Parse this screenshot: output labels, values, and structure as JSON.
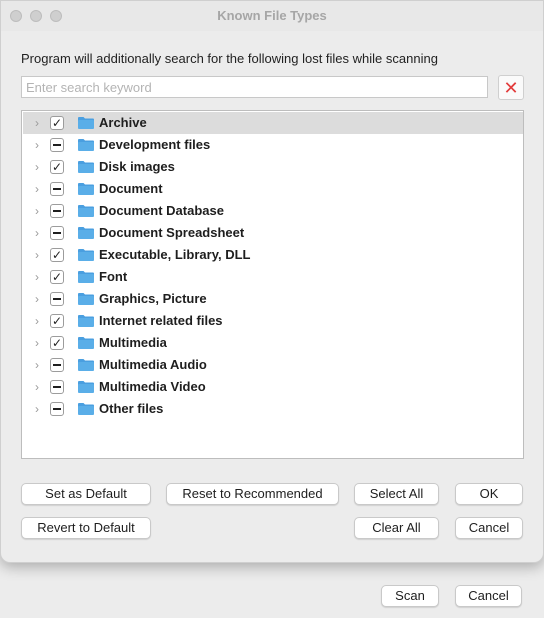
{
  "window": {
    "title": "Known File Types"
  },
  "instruction": "Program will additionally search for the following lost files while scanning",
  "search": {
    "placeholder": "Enter search keyword",
    "value": ""
  },
  "file_types": [
    {
      "label": "Archive",
      "state": "checked",
      "selected": true
    },
    {
      "label": "Development files",
      "state": "mixed",
      "selected": false
    },
    {
      "label": "Disk images",
      "state": "checked",
      "selected": false
    },
    {
      "label": "Document",
      "state": "mixed",
      "selected": false
    },
    {
      "label": "Document Database",
      "state": "mixed",
      "selected": false
    },
    {
      "label": "Document Spreadsheet",
      "state": "mixed",
      "selected": false
    },
    {
      "label": "Executable, Library, DLL",
      "state": "checked",
      "selected": false
    },
    {
      "label": "Font",
      "state": "checked",
      "selected": false
    },
    {
      "label": "Graphics, Picture",
      "state": "mixed",
      "selected": false
    },
    {
      "label": "Internet related files",
      "state": "checked",
      "selected": false
    },
    {
      "label": "Multimedia",
      "state": "checked",
      "selected": false
    },
    {
      "label": "Multimedia Audio",
      "state": "mixed",
      "selected": false
    },
    {
      "label": "Multimedia Video",
      "state": "mixed",
      "selected": false
    },
    {
      "label": "Other files",
      "state": "mixed",
      "selected": false
    }
  ],
  "buttons": {
    "set_as_default": "Set as Default",
    "reset_to_recommended": "Reset to Recommended",
    "select_all": "Select All",
    "ok": "OK",
    "revert_to_default": "Revert to Default",
    "clear_all": "Clear All",
    "cancel": "Cancel"
  },
  "background_window": {
    "scan": "Scan",
    "cancel": "Cancel"
  },
  "colors": {
    "folder": "#5aaee8",
    "clear_icon": "#e23b3b",
    "selected_row": "#dcdcdc"
  },
  "icons": [
    "folder-icon",
    "chevron-right-icon",
    "checkbox-checked-icon",
    "checkbox-mixed-icon",
    "close-icon"
  ]
}
